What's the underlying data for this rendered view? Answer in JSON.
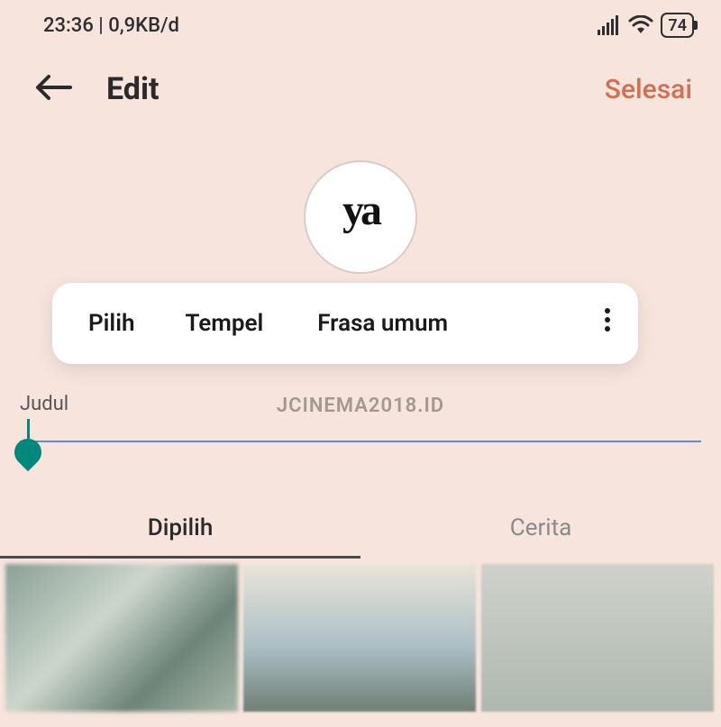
{
  "status": {
    "time": "23:36",
    "net_speed": "0,9KB/d",
    "battery": "74"
  },
  "header": {
    "title": "Edit",
    "done_label": "Selesai"
  },
  "avatar": {
    "text": "ya"
  },
  "context_menu": {
    "select": "Pilih",
    "paste": "Tempel",
    "phrases": "Frasa umum"
  },
  "title_field": {
    "label": "Judul",
    "value": ""
  },
  "watermark": "JCINEMA2018.ID",
  "tabs": {
    "selected": "Dipilih",
    "story": "Cerita"
  }
}
